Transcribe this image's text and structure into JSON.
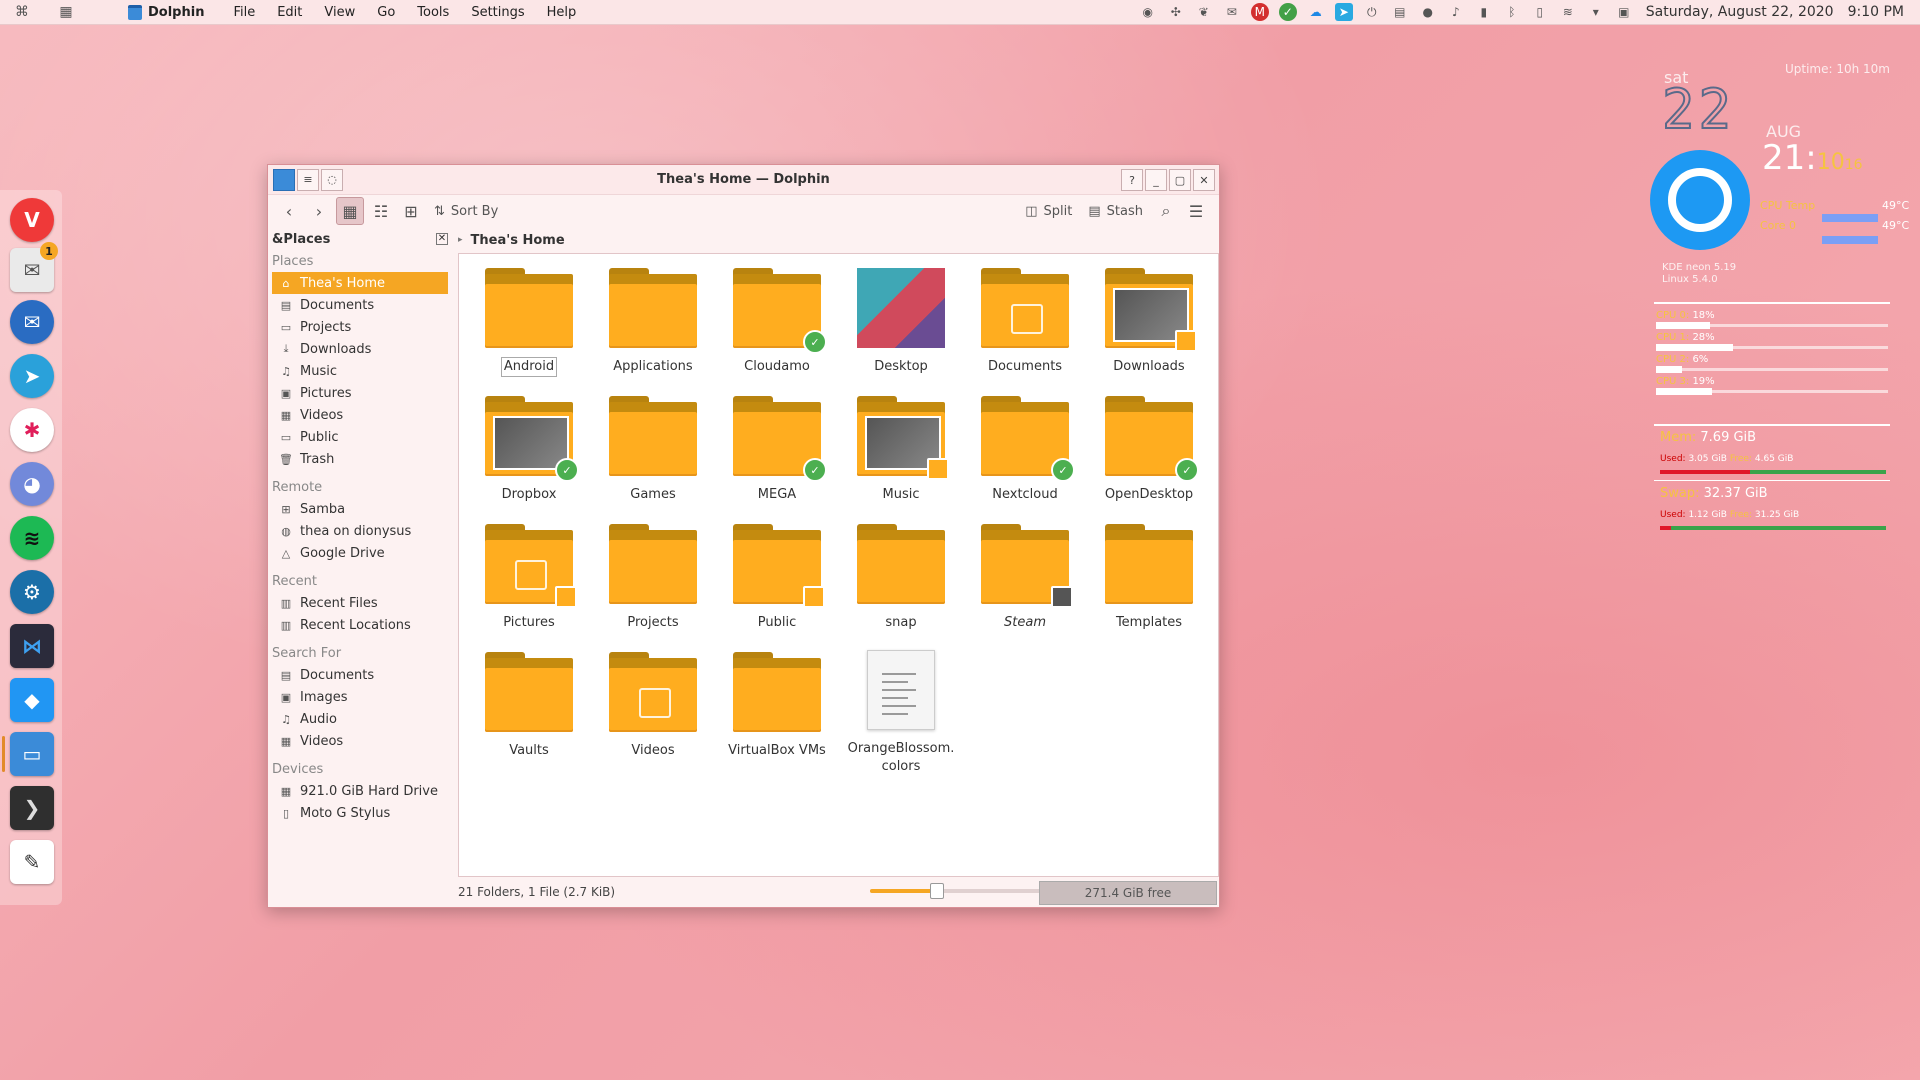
{
  "topbar": {
    "app_name": "Dolphin",
    "menu": [
      "File",
      "Edit",
      "View",
      "Go",
      "Tools",
      "Settings",
      "Help"
    ],
    "date": "Saturday, August 22, 2020",
    "time": "9:10 PM"
  },
  "dock": {
    "mail_badge": "1"
  },
  "window": {
    "title": "Thea's Home — Dolphin",
    "toolbar": {
      "sort_label": "Sort By",
      "split_label": "Split",
      "stash_label": "Stash"
    },
    "sidebar": {
      "header": "&Places",
      "sections": [
        {
          "title": "Places",
          "items": [
            {
              "label": "Thea's Home",
              "icon": "home-icon",
              "selected": true
            },
            {
              "label": "Documents",
              "icon": "document-icon"
            },
            {
              "label": "Projects",
              "icon": "folder-icon"
            },
            {
              "label": "Downloads",
              "icon": "download-icon"
            },
            {
              "label": "Music",
              "icon": "music-icon"
            },
            {
              "label": "Pictures",
              "icon": "picture-icon"
            },
            {
              "label": "Videos",
              "icon": "video-icon"
            },
            {
              "label": "Public",
              "icon": "folder-icon"
            },
            {
              "label": "Trash",
              "icon": "trash-icon"
            }
          ]
        },
        {
          "title": "Remote",
          "items": [
            {
              "label": "Samba",
              "icon": "network-icon"
            },
            {
              "label": "thea on dionysus",
              "icon": "globe-icon"
            },
            {
              "label": "Google Drive",
              "icon": "cloud-icon"
            }
          ]
        },
        {
          "title": "Recent",
          "items": [
            {
              "label": "Recent Files",
              "icon": "recent-icon"
            },
            {
              "label": "Recent Locations",
              "icon": "recent-icon"
            }
          ]
        },
        {
          "title": "Search For",
          "items": [
            {
              "label": "Documents",
              "icon": "document-icon"
            },
            {
              "label": "Images",
              "icon": "picture-icon"
            },
            {
              "label": "Audio",
              "icon": "music-icon"
            },
            {
              "label": "Videos",
              "icon": "video-icon"
            }
          ]
        },
        {
          "title": "Devices",
          "items": [
            {
              "label": "921.0 GiB Hard Drive",
              "icon": "drive-icon"
            },
            {
              "label": "Moto G Stylus",
              "icon": "phone-icon"
            }
          ]
        }
      ]
    },
    "breadcrumb": "Thea's Home",
    "files": [
      {
        "name": "Android",
        "type": "folder"
      },
      {
        "name": "Applications",
        "type": "folder"
      },
      {
        "name": "Cloudamo",
        "type": "folder",
        "badge": "check"
      },
      {
        "name": "Desktop",
        "type": "desktop"
      },
      {
        "name": "Documents",
        "type": "folder",
        "emblem": "doc"
      },
      {
        "name": "Downloads",
        "type": "folder",
        "thumb": true,
        "badge": "shared"
      },
      {
        "name": "Dropbox",
        "type": "folder",
        "thumb": true,
        "badge": "check"
      },
      {
        "name": "Games",
        "type": "folder"
      },
      {
        "name": "MEGA",
        "type": "folder",
        "badge": "check"
      },
      {
        "name": "Music",
        "type": "folder",
        "thumb": true,
        "badge": "shared"
      },
      {
        "name": "Nextcloud",
        "type": "folder",
        "badge": "check"
      },
      {
        "name": "OpenDesktop",
        "type": "folder",
        "badge": "check"
      },
      {
        "name": "Pictures",
        "type": "folder",
        "emblem": "image",
        "badge": "shared"
      },
      {
        "name": "Projects",
        "type": "folder"
      },
      {
        "name": "Public",
        "type": "folder",
        "badge": "shared"
      },
      {
        "name": "snap",
        "type": "folder"
      },
      {
        "name": "Steam",
        "type": "folder",
        "italic": true,
        "badge": "link"
      },
      {
        "name": "Templates",
        "type": "folder"
      },
      {
        "name": "Vaults",
        "type": "folder"
      },
      {
        "name": "Videos",
        "type": "folder",
        "emblem": "video"
      },
      {
        "name": "VirtualBox VMs",
        "type": "folder"
      },
      {
        "name": "OrangeBlossom.\ncolors",
        "type": "file"
      }
    ],
    "status": {
      "summary": "21 Folders, 1 File (2.7 KiB)",
      "zoom_fraction": 0.38,
      "free_space": "271.4 GiB free"
    }
  },
  "conky": {
    "uptime": "Uptime: 10h 10m",
    "day": "sat",
    "date": "22",
    "month": "AUG",
    "time_hm": "21:",
    "time_m": "10",
    "time_s": "16",
    "temp_labels": [
      "CPU Temp",
      "Core 0"
    ],
    "temps": [
      "49°C",
      "49°C"
    ],
    "kde_info": [
      "KDE neon 5.19",
      "Linux 5.4.0"
    ],
    "cpus": [
      {
        "label": "CPU 0:",
        "value": "18%",
        "frac": 0.18
      },
      {
        "label": "CPU 1:",
        "value": "28%",
        "frac": 0.28
      },
      {
        "label": "CPU 2:",
        "value": "6%",
        "frac": 0.06
      },
      {
        "label": "CPU 3:",
        "value": "19%",
        "frac": 0.19
      }
    ],
    "mem": {
      "label": "Mem:",
      "value": "7.69 GiB",
      "used_label": "Used:",
      "used": "3.05 GiB",
      "free_label": "Free:",
      "free": "4.65 GiB",
      "frac": 0.4
    },
    "swap": {
      "label": "Swap:",
      "value": "32.37 GiB",
      "used_label": "Used:",
      "used": "1.12 GiB",
      "free_label": "Free:",
      "free": "31.25 GiB",
      "frac": 0.03
    }
  }
}
